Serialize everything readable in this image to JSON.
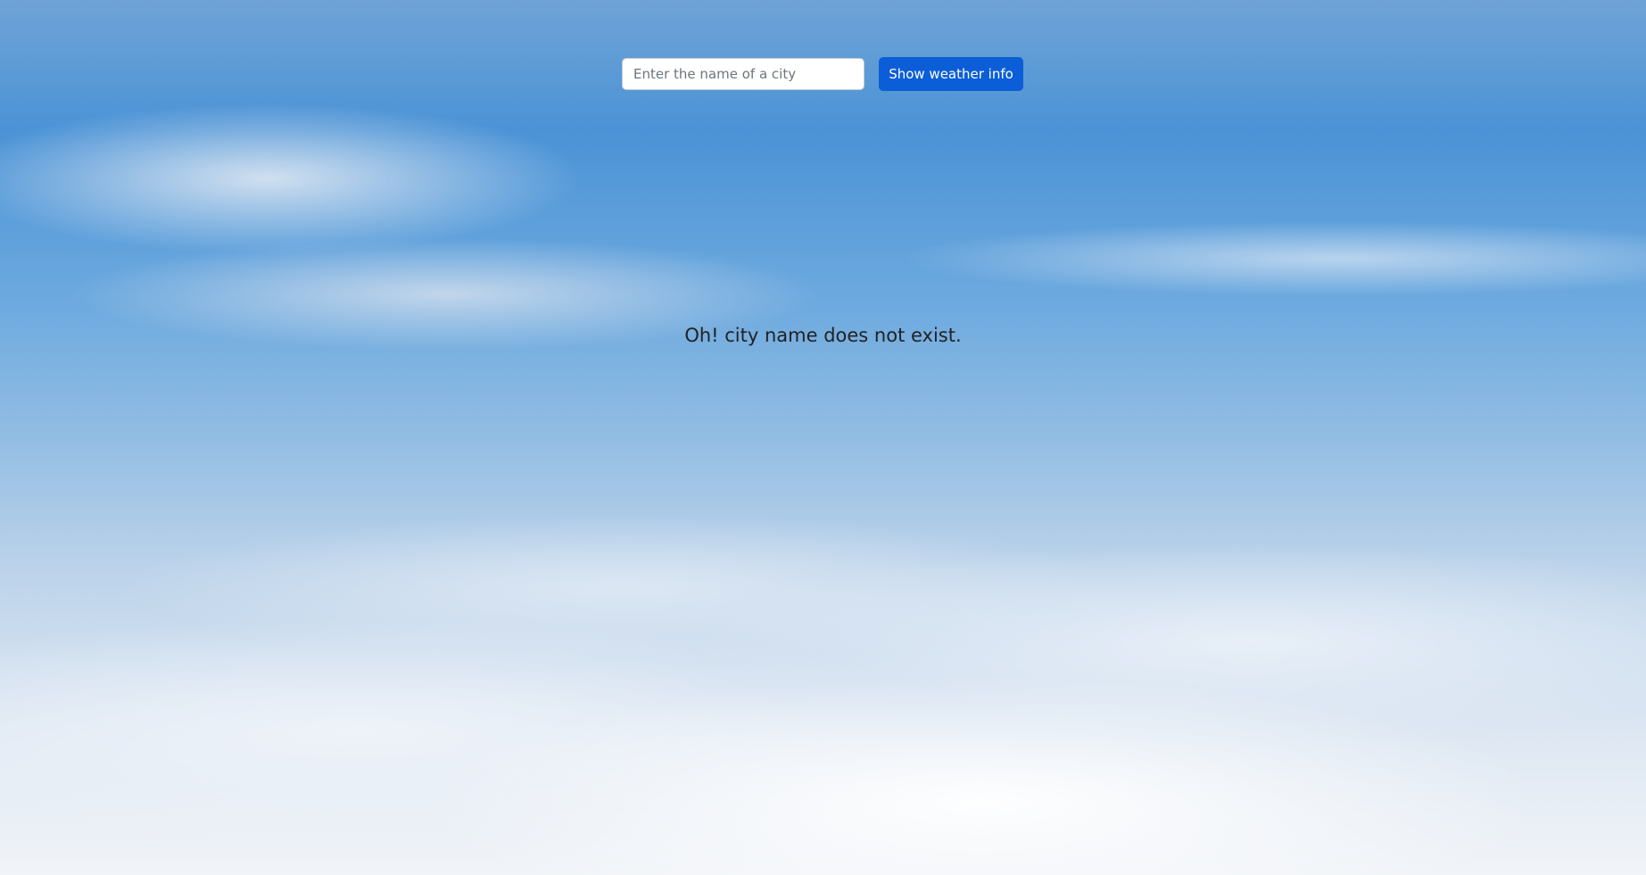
{
  "search": {
    "placeholder": "Enter the name of a city",
    "value": ""
  },
  "button": {
    "label": "Show weather info"
  },
  "message": "Oh! city name does not exist.",
  "colors": {
    "button": "#0b5ed7"
  }
}
